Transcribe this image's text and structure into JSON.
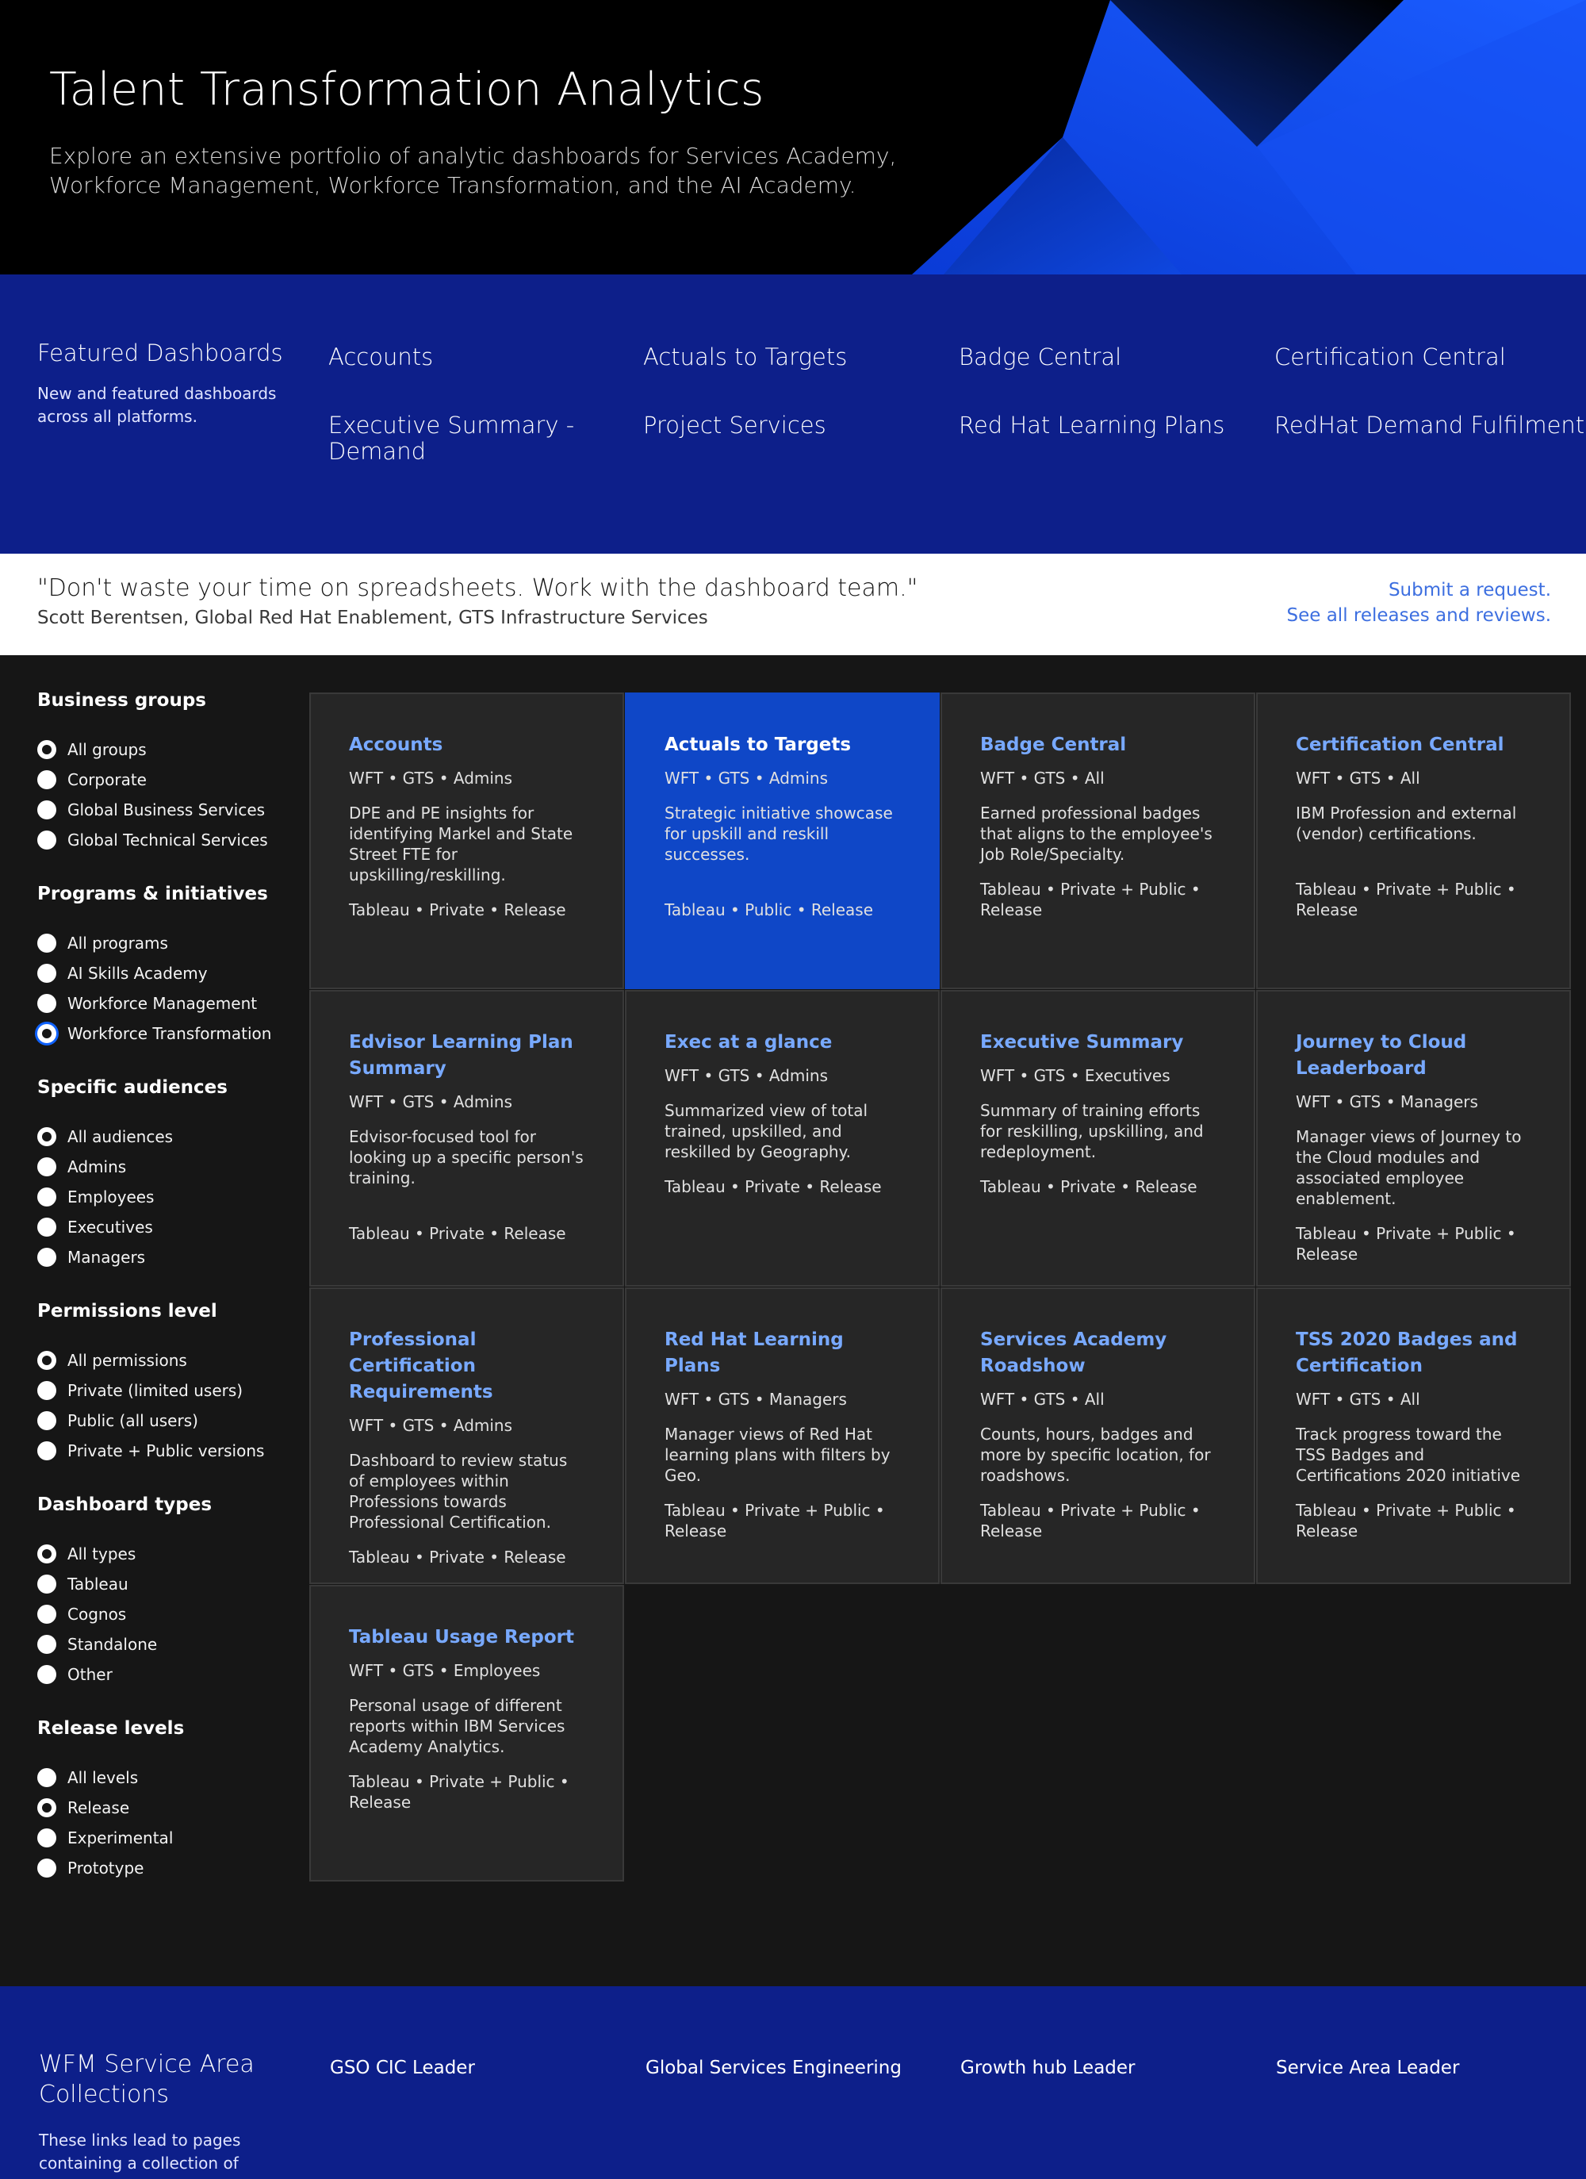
{
  "hero": {
    "title": "Talent Transformation Analytics",
    "subtitle": "Explore an extensive portfolio of analytic dashboards for Services Academy, Workforce Management, Workforce Transformation, and the AI Academy."
  },
  "featured": {
    "title": "Featured Dashboards",
    "description": "New and featured dashboards across all platforms.",
    "links": [
      "Accounts",
      "Actuals to Targets",
      "Badge Central",
      "Certification Central",
      "Executive Summary - Demand",
      "Project Services",
      "Red Hat Learning Plans",
      "RedHat Demand Fulfilment"
    ]
  },
  "quote": {
    "text": "\"Don't waste your time on spreadsheets. Work with the dashboard team.\"",
    "author": "Scott Berentsen, Global Red Hat Enablement, GTS Infrastructure Services",
    "links": [
      "Submit a request.",
      "See all releases and reviews."
    ]
  },
  "filters": [
    {
      "title": "Business groups",
      "options": [
        "All groups",
        "Corporate",
        "Global Business Services",
        "Global Technical Services"
      ],
      "selected": 0
    },
    {
      "title": "Programs & initiatives",
      "options": [
        "All programs",
        "AI Skills Academy",
        "Workforce Management",
        "Workforce Transformation"
      ],
      "selected": 3
    },
    {
      "title": "Specific audiences",
      "options": [
        "All audiences",
        "Admins",
        "Employees",
        "Executives",
        "Managers"
      ],
      "selected": 0
    },
    {
      "title": "Permissions level",
      "options": [
        "All permissions",
        "Private (limited users)",
        "Public (all users)",
        "Private + Public versions"
      ],
      "selected": 0
    },
    {
      "title": "Dashboard types",
      "options": [
        "All types",
        "Tableau",
        "Cognos",
        "Standalone",
        "Other"
      ],
      "selected": 0
    },
    {
      "title": "Release levels",
      "options": [
        "All levels",
        "Release",
        "Experimental",
        "Prototype"
      ],
      "selected": 1
    }
  ],
  "cards": [
    {
      "title": "Accounts",
      "meta": "WFT • GTS • Admins",
      "desc": "DPE and PE insights for identifying Markel and State Street FTE for upskilling/reskilling.",
      "tags": "Tableau • Private • Release"
    },
    {
      "title": "Actuals to Targets",
      "meta": "WFT • GTS • Admins",
      "desc": "Strategic initiative showcase for upskill and reskill successes.",
      "tags": "Tableau • Public • Release"
    },
    {
      "title": "Badge Central",
      "meta": "WFT • GTS • All",
      "desc": "Earned professional badges that aligns to the employee's Job Role/Specialty.",
      "tags": "Tableau • Private + Public • Release"
    },
    {
      "title": "Certification Central",
      "meta": "WFT • GTS • All",
      "desc": "IBM Profession and external (vendor) certifications.",
      "tags": "Tableau • Private + Public • Release"
    },
    {
      "title": "Edvisor Learning Plan Summary",
      "meta": "WFT • GTS • Admins",
      "desc": "Edvisor-focused tool for looking up a specific person's training.",
      "tags": "Tableau • Private • Release"
    },
    {
      "title": "Exec at a glance",
      "meta": "WFT • GTS • Admins",
      "desc": "Summarized view of total trained, upskilled, and reskilled by Geography.",
      "tags": "Tableau • Private • Release"
    },
    {
      "title": "Executive Summary",
      "meta": "WFT • GTS • Executives",
      "desc": "Summary of training efforts for reskilling, upskilling, and redeployment.",
      "tags": "Tableau • Private • Release"
    },
    {
      "title": "Journey to Cloud Leaderboard",
      "meta": "WFT • GTS • Managers",
      "desc": "Manager views of Journey to the Cloud modules and associated employee enablement.",
      "tags": "Tableau • Private + Public • Release"
    },
    {
      "title": "Professional Certification Requirements",
      "meta": "WFT • GTS • Admins",
      "desc": "Dashboard to review status of employees within Professions towards Professional Certification.",
      "tags": "Tableau • Private • Release"
    },
    {
      "title": "Red Hat Learning Plans",
      "meta": "WFT • GTS • Managers",
      "desc": "Manager views of Red Hat learning plans with filters by Geo.",
      "tags": "Tableau • Private + Public • Release"
    },
    {
      "title": "Services Academy Roadshow",
      "meta": "WFT • GTS • All",
      "desc": "Counts, hours, badges and more by specific location, for roadshows.",
      "tags": "Tableau • Private + Public • Release"
    },
    {
      "title": "TSS 2020 Badges and Certification",
      "meta": "WFT • GTS • All",
      "desc": "Track progress toward the TSS Badges and Certifications 2020 initiative",
      "tags": "Tableau • Private + Public • Release"
    },
    {
      "title": "Tableau Usage Report",
      "meta": "WFT • GTS • Employees",
      "desc": "Personal usage of different reports within IBM Services Academy Analytics.",
      "tags": "Tableau • Private + Public • Release"
    }
  ],
  "footer": {
    "title": "WFM Service Area Collections",
    "description": "These links lead to pages containing a collection of Service",
    "links": [
      "GSO CIC Leader",
      "Global Services Engineering",
      "Growth hub Leader",
      "Service Area Leader"
    ]
  },
  "colors": {
    "hero_bg": "#000000",
    "band_blue": "#0d1f8a",
    "card_bg": "#262626",
    "card_highlight": "#0f47c7",
    "card_title": "#78a9ff",
    "link_blue": "#3d6fe0"
  }
}
